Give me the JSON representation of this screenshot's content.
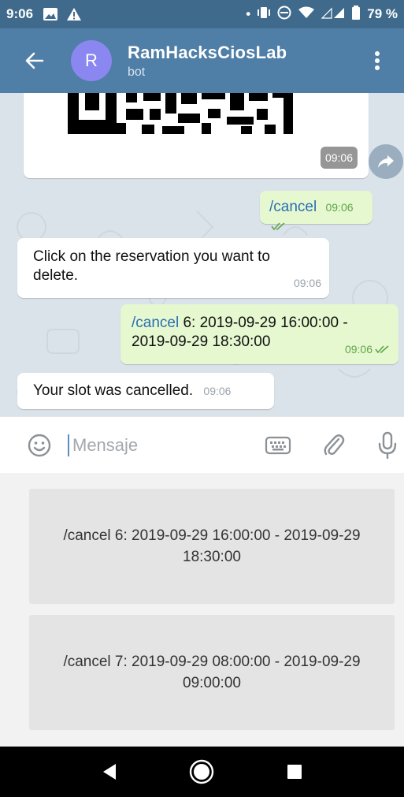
{
  "status_bar": {
    "time": "9:06",
    "battery": "79 %"
  },
  "header": {
    "avatar_letter": "R",
    "title": "RamHacksCiosLab",
    "subtitle": "bot"
  },
  "messages": [
    {
      "type": "image",
      "time": "09:06"
    },
    {
      "type": "outgoing",
      "command": "/cancel",
      "text": "",
      "time": "09:06"
    },
    {
      "type": "incoming",
      "text": "Click on the reservation you want to delete.",
      "time": "09:06"
    },
    {
      "type": "outgoing",
      "command": "/cancel",
      "text": " 6: 2019-09-29 16:00:00 - 2019-09-29 18:30:00",
      "time": "09:06"
    },
    {
      "type": "incoming",
      "text": "Your slot was cancelled.",
      "time": "09:06"
    }
  ],
  "input": {
    "placeholder": "Mensaje"
  },
  "keyboard_buttons": [
    "/cancel 6: 2019-09-29 16:00:00 - 2019-09-29 18:30:00",
    "/cancel 7: 2019-09-29 08:00:00 - 2019-09-29 09:00:00"
  ],
  "colors": {
    "header": "#4f7ea6",
    "status_bar": "#3f6a8c",
    "avatar": "#8b87f0",
    "outgoing_bubble": "#e6f8d0",
    "command_link": "#2a6eb4"
  },
  "icons": {
    "back": "arrow-left-icon",
    "menu": "more-vertical-icon",
    "emoji": "smiley-icon",
    "keyboard": "keyboard-icon",
    "attach": "paperclip-icon",
    "mic": "microphone-icon",
    "share": "forward-icon"
  }
}
